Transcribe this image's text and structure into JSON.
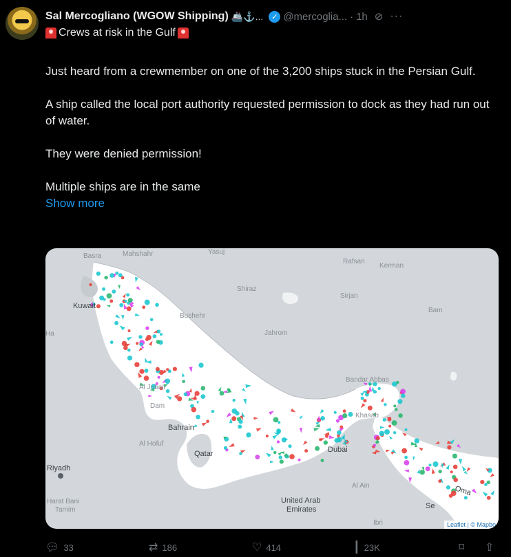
{
  "author": {
    "display_name": "Sal Mercogliano (WGOW Shipping)",
    "name_emojis": "🚢⚓...",
    "handle": "@mercoglia...",
    "time": "1h"
  },
  "post": {
    "subtitle": "Crews at risk in the Gulf",
    "paragraphs": [
      "Just heard from a crewmember on one of the 3,200 ships stuck in the Persian Gulf.",
      "A ship called the local port authority requested permission to dock as they had run out of water.",
      "They were denied permission!",
      "Multiple ships are in the same"
    ],
    "show_more": "Show more"
  },
  "map": {
    "labels": {
      "basra": "Basra",
      "mahshahr": "Mahshahr",
      "yasuj": "Yasuj",
      "rafsanjan": "Rafsan",
      "kerman": "Kerman",
      "shiraz": "Shiraz",
      "sirjan": "Sirjan",
      "bam": "Bam",
      "kuwait": "Kuwait",
      "bushehr": "Bushehr",
      "jahrom": "Jahrom",
      "ha": "Ha",
      "bandar_abbas": "Bandar Abbas",
      "jubail": "Al Jubail",
      "dammam": "Dam",
      "bahrain": "Bahrain",
      "khasab": "Khasab",
      "hofuf": "Al Hofuf",
      "qatar": "Qatar",
      "dubai": "Dubai",
      "riyadh": "Riyadh",
      "al_ain": "Al Ain",
      "uae_line1": "United Arab",
      "uae_line2": "Emirates",
      "oman": "Oma",
      "muscat": "Se",
      "haradh_line1": "Harat Bani",
      "haradh_line2": "Tamim",
      "ibri": "Ibri"
    },
    "attribution": "Leaflet | © Mapbo"
  },
  "actions": {
    "replies": "33",
    "reposts": "186",
    "likes": "414",
    "views": "23K"
  },
  "colors": {
    "background": "#000000",
    "text": "#e7e9ea",
    "muted": "#71767b",
    "link": "#1d9bf0",
    "map_land": "#d3d7db",
    "map_water": "#ffffff",
    "ship_cyan": "#1ec8d0",
    "ship_red": "#e8413c",
    "ship_green": "#2eb872",
    "ship_magenta": "#d946ef"
  }
}
